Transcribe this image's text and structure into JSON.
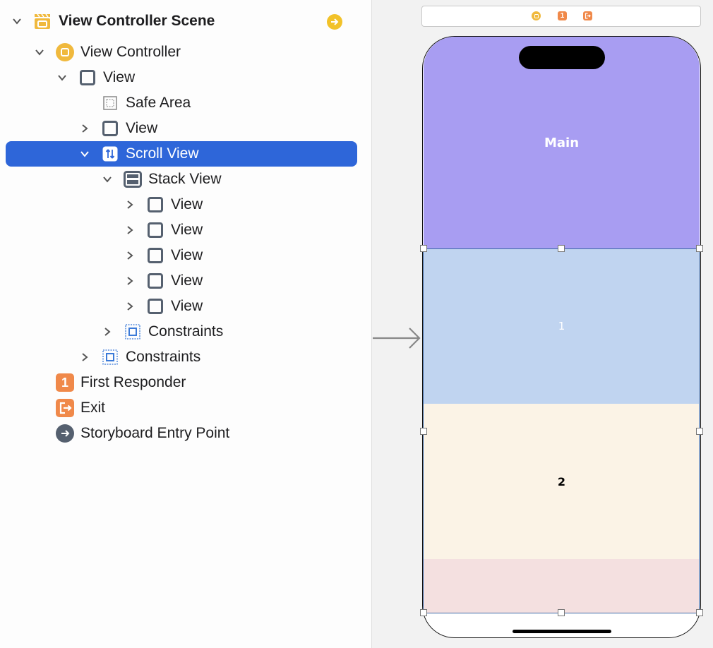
{
  "outline": {
    "rows": [
      {
        "label": "View Controller Scene"
      },
      {
        "label": "View Controller"
      },
      {
        "label": "View"
      },
      {
        "label": "Safe Area"
      },
      {
        "label": "View"
      },
      {
        "label": "Scroll View"
      },
      {
        "label": "Stack View"
      },
      {
        "label": "View"
      },
      {
        "label": "View"
      },
      {
        "label": "View"
      },
      {
        "label": "View"
      },
      {
        "label": "View"
      },
      {
        "label": "Constraints"
      },
      {
        "label": "Constraints"
      },
      {
        "label": "First Responder",
        "badge": "1"
      },
      {
        "label": "Exit"
      },
      {
        "label": "Storyboard Entry Point"
      }
    ],
    "selected_row": "Scroll View"
  },
  "canvas": {
    "scene_bar_icons": [
      "view-controller-icon",
      "first-responder-icon",
      "exit-icon"
    ],
    "scene_bar_badge": "1",
    "blocks": [
      {
        "label": "Main",
        "color": "#a89df2",
        "label_color": "#ffffff"
      },
      {
        "label": "1",
        "color": "#c0d4f0",
        "label_color": "#ffffff"
      },
      {
        "label": "2",
        "color": "#fbf3e6",
        "label_color": "#000000"
      },
      {
        "label": "",
        "color": "#f4e0e0"
      }
    ]
  },
  "colors": {
    "selection": "#2e66d9",
    "icon_gray": "#55606f",
    "vc_yellow": "#f0b93d",
    "badge_orange": "#f0894a"
  }
}
